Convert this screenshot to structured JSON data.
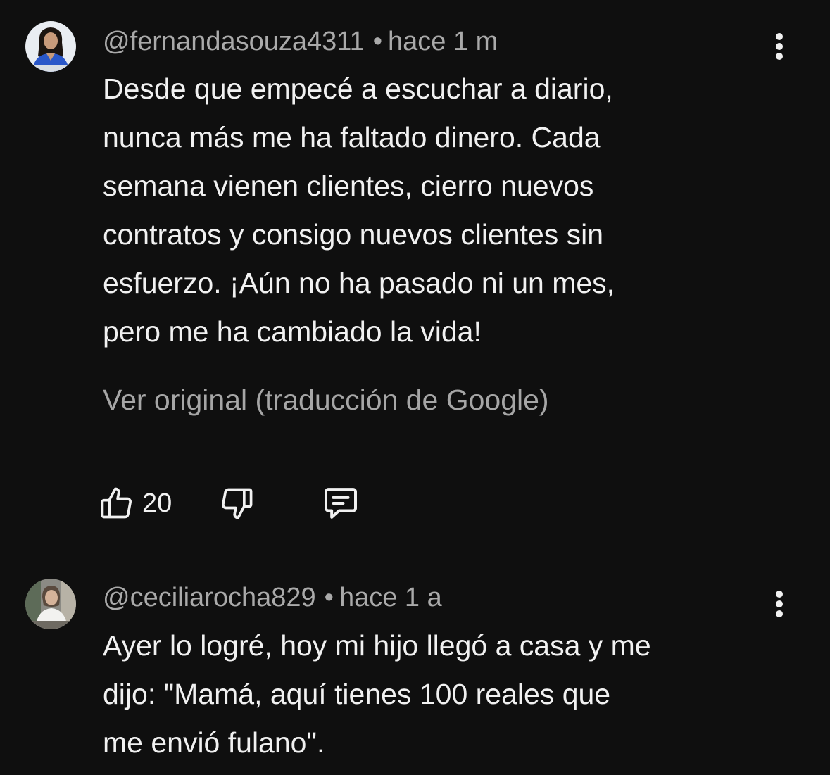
{
  "comments": [
    {
      "author": "@fernandasouza4311",
      "separator": "•",
      "time": "hace 1 m",
      "text_lines": [
        "Desde que empecé a escuchar a diario,",
        "nunca más me ha faltado dinero. Cada",
        "semana vienen clientes, cierro nuevos",
        "contratos y consigo nuevos clientes sin",
        "esfuerzo. ¡Aún no ha pasado ni un mes,",
        "pero me ha cambiado la vida!"
      ],
      "translation_link": "Ver original (traducción de Google)",
      "like_count": "20",
      "icons": {
        "like": "thumb-up-icon",
        "dislike": "thumb-down-icon",
        "reply": "comment-icon",
        "menu": "more-vert-icon"
      }
    },
    {
      "author": "@ceciliarocha829",
      "separator": "•",
      "time": "hace 1 a",
      "text_lines": [
        "Ayer lo logré, hoy mi hijo llegó a casa y me",
        "dijo: \"Mamá, aquí tienes 100 reales que",
        "me envió fulano\"."
      ],
      "icons": {
        "menu": "more-vert-icon"
      }
    }
  ],
  "colors": {
    "background": "#0f0f0f",
    "primary_text": "#f1f1f1",
    "secondary_text": "#aaaaaa"
  }
}
